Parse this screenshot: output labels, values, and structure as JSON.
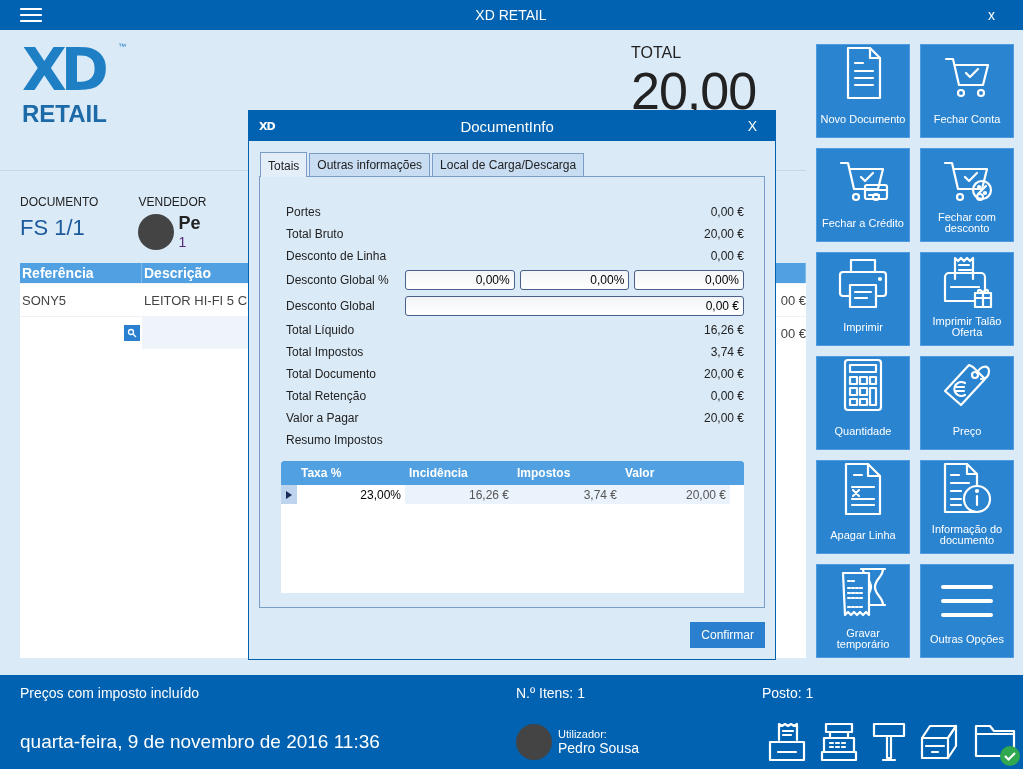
{
  "app_bar": {
    "title": "XD RETAIL",
    "close": "x"
  },
  "logo": {
    "mark": "XD",
    "tm": "™",
    "wordmark": "RETAIL"
  },
  "total": {
    "label": "TOTAL",
    "value": "20,00"
  },
  "document": {
    "label": "DOCUMENTO",
    "value": "FS 1/1"
  },
  "vendor": {
    "label": "VENDEDOR",
    "name": "Pe",
    "number": "1"
  },
  "lines_table": {
    "columns": [
      "Referência",
      "Descrição"
    ],
    "rows": [
      {
        "reference": "SONY5",
        "description": "LEITOR HI-FI 5 C",
        "column_3": "00 €"
      }
    ],
    "entry_row": {
      "column_3": "00 €"
    }
  },
  "actions": [
    {
      "label": "Novo Documento"
    },
    {
      "label": "Fechar Conta"
    },
    {
      "label": "Fechar a Crédito"
    },
    {
      "label": "Fechar com desconto"
    },
    {
      "label": "Imprimir"
    },
    {
      "label": "Imprimir Talão Oferta"
    },
    {
      "label": "Quantidade"
    },
    {
      "label": "Preço"
    },
    {
      "label": "Apagar Linha"
    },
    {
      "label": "Informação do documento"
    },
    {
      "label": "Gravar temporário"
    },
    {
      "label": "Outras Opções"
    }
  ],
  "status_bar": {
    "tax_note": "Preços com imposto incluído",
    "items_count": "N.º Itens: 1",
    "station": "Posto: 1",
    "datetime": "quarta-feira, 9 de novembro de 2016 11:36",
    "user_label": "Utilizador:",
    "user_name": "Pedro Sousa"
  },
  "dialog": {
    "logo": "XD",
    "title": "DocumentInfo",
    "close": "X",
    "tabs": [
      {
        "label": "Totais",
        "selected": true
      },
      {
        "label": "Outras informações",
        "selected": false
      },
      {
        "label": "Local de Carga/Descarga",
        "selected": false
      }
    ],
    "totals": [
      {
        "kind": "value",
        "label": "Portes",
        "value": "0,00 €"
      },
      {
        "kind": "value",
        "label": "Total Bruto",
        "value": "20,00 €"
      },
      {
        "kind": "value",
        "label": "Desconto de Linha",
        "value": "0,00 €"
      },
      {
        "kind": "fields",
        "label": "Desconto Global %",
        "values": [
          "0,00%",
          "0,00%",
          "0,00%"
        ]
      },
      {
        "kind": "fields",
        "label": "Desconto Global",
        "values": [
          "0,00 €"
        ]
      },
      {
        "kind": "value",
        "label": "Total Líquido",
        "value": "16,26 €"
      },
      {
        "kind": "value",
        "label": "Total Impostos",
        "value": "3,74 €"
      },
      {
        "kind": "value",
        "label": "Total Documento",
        "value": "20,00 €"
      },
      {
        "kind": "value",
        "label": "Total Retenção",
        "value": "0,00 €"
      },
      {
        "kind": "value",
        "label": "Valor a Pagar",
        "value": "20,00 €"
      }
    ],
    "tax_summary": {
      "label": "Resumo Impostos",
      "columns": [
        "Taxa %",
        "Incidência",
        "Impostos",
        "Valor"
      ],
      "rows": [
        {
          "selected": true,
          "cells": [
            "23,00%",
            "16,26 €",
            "3,74 €",
            "20,00 €"
          ]
        }
      ]
    },
    "confirm": "Confirmar"
  }
}
